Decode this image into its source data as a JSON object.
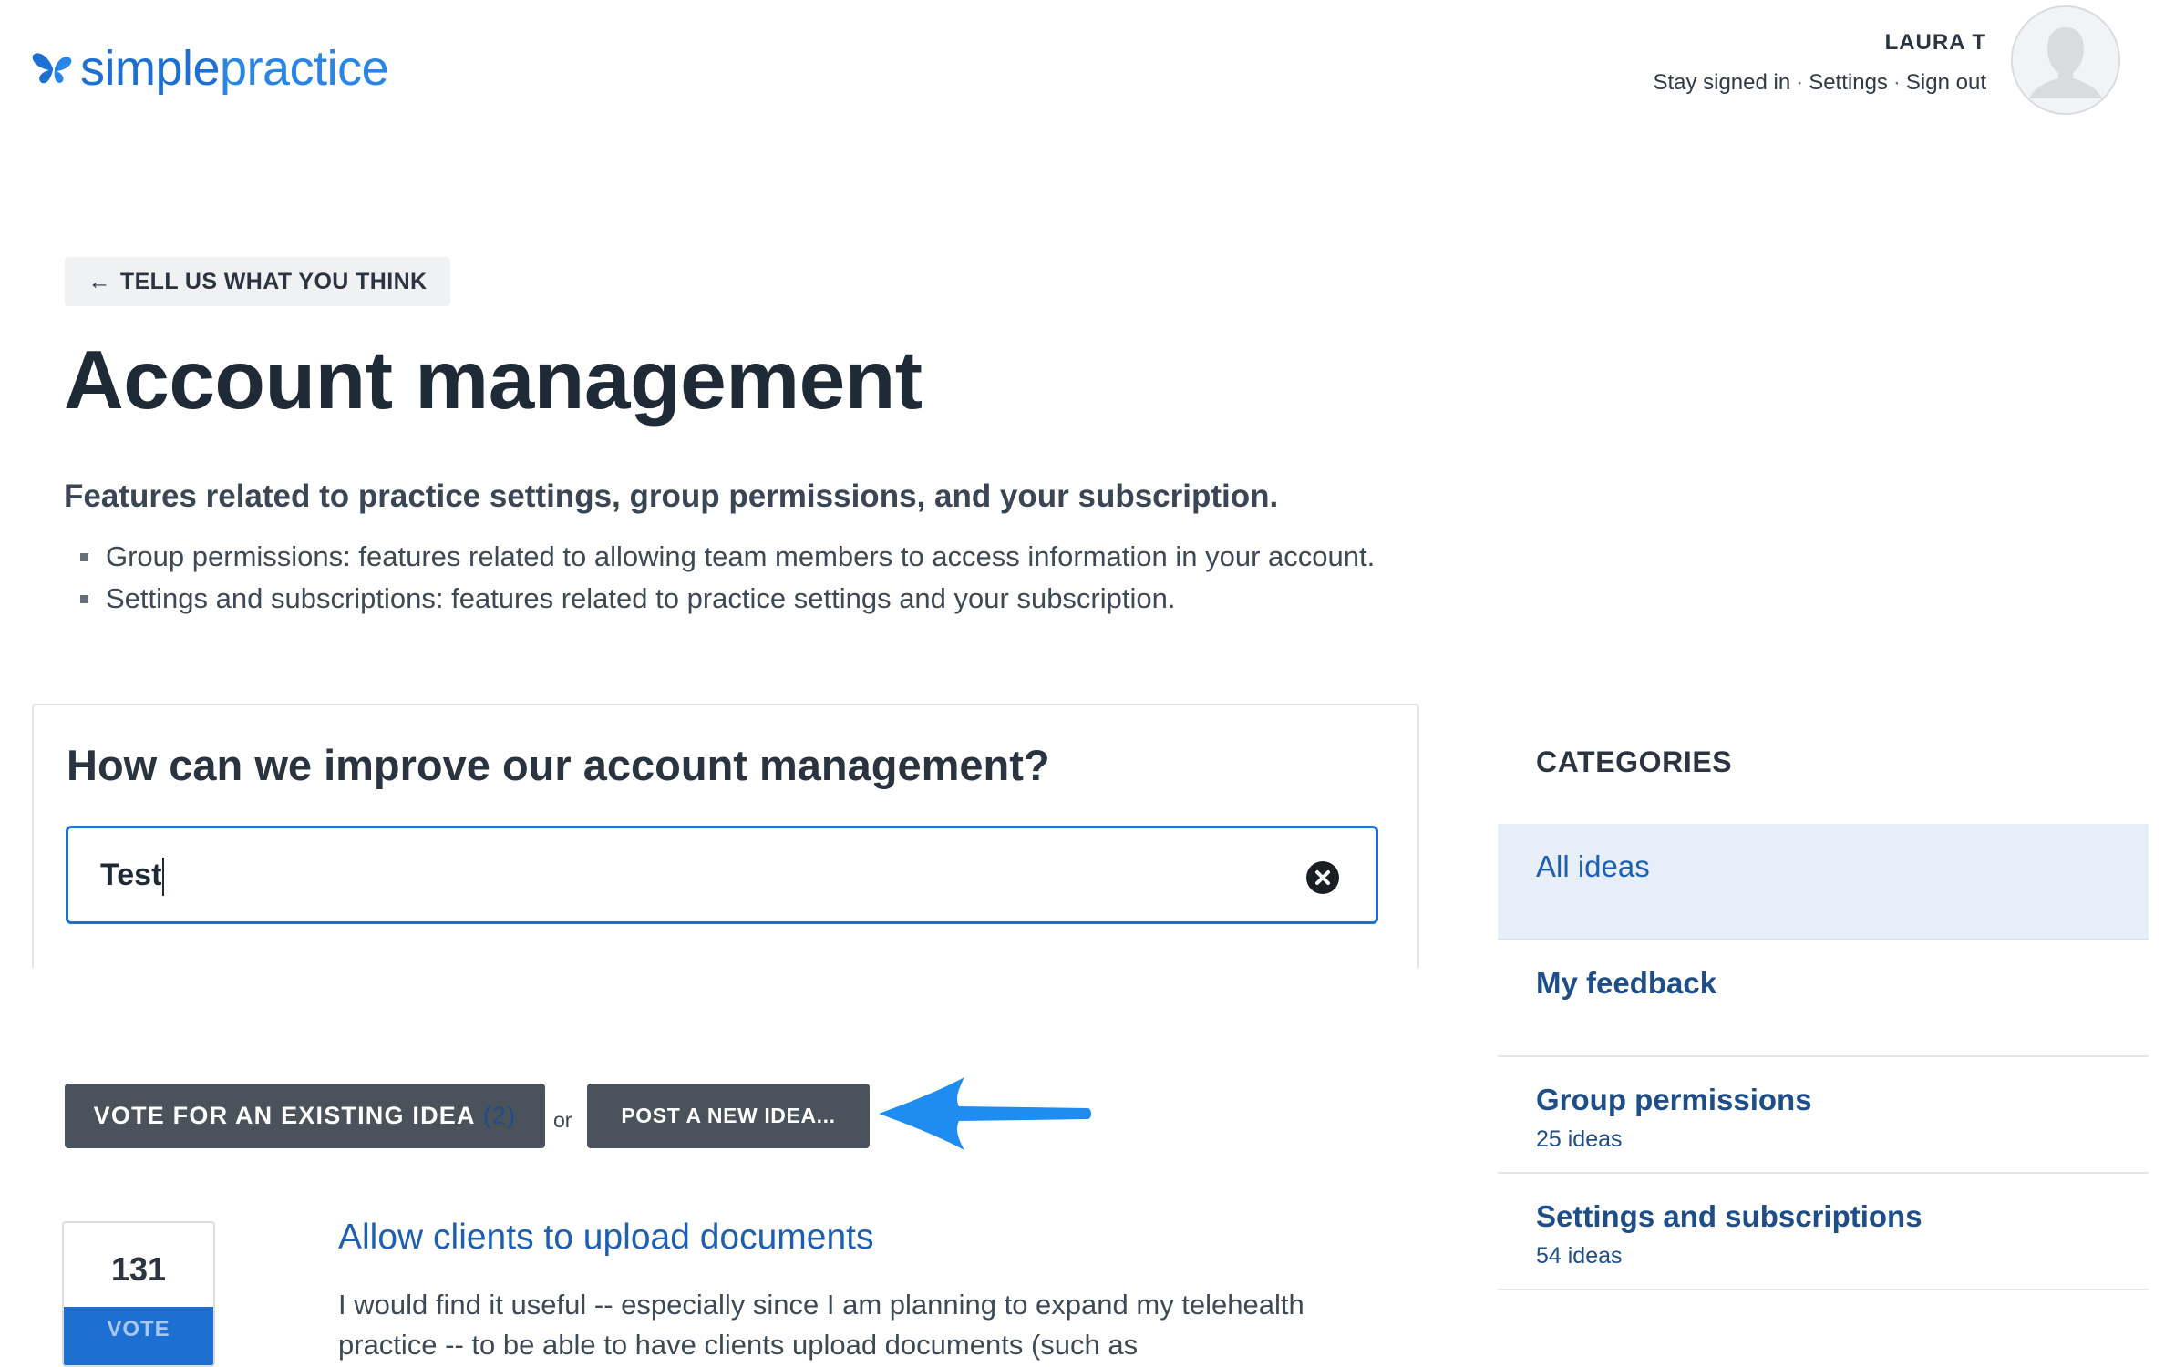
{
  "header": {
    "logo": {
      "text_bold": "simple",
      "text_light": "practice"
    },
    "user": {
      "name": "LAURA T",
      "links": [
        "Stay signed in",
        "Settings",
        "Sign out"
      ],
      "separator": "·"
    }
  },
  "breadcrumb": {
    "label": "TELL US WHAT YOU THINK",
    "arrow": "←"
  },
  "page": {
    "title": "Account management",
    "intro": "Features related to practice settings, group permissions, and your subscription.",
    "bullets": [
      "Group permissions: features related to allowing team members to access information in your account.",
      "Settings and subscriptions: features related to practice settings and your subscription."
    ]
  },
  "search": {
    "heading": "How can we improve our account management?",
    "value": "Test",
    "clear_icon": "close-circle-icon"
  },
  "actions": {
    "vote_existing_label": "VOTE FOR AN EXISTING IDEA",
    "vote_existing_count": "(2)",
    "or_text": "or",
    "post_new_label": "POST A NEW IDEA...",
    "arrow_color": "#1e8cf0"
  },
  "ideas": [
    {
      "votes": "131",
      "vote_label": "VOTE",
      "title": "Allow clients to upload documents",
      "description": "I would find it useful -- especially since I am planning to expand my telehealth practice -- to be able to have clients upload documents (such as"
    }
  ],
  "sidebar": {
    "heading": "CATEGORIES",
    "items": [
      {
        "label": "All ideas",
        "count": "",
        "active": true
      },
      {
        "label": "My feedback",
        "count": ""
      },
      {
        "label": "Group permissions",
        "count": "25 ideas"
      },
      {
        "label": "Settings and subscriptions",
        "count": "54 ideas"
      }
    ]
  },
  "colors": {
    "brand_blue": "#1d6fd1",
    "link_blue": "#1d4e89",
    "dark_button": "#4a525b",
    "active_category_bg": "#e6eef8"
  }
}
